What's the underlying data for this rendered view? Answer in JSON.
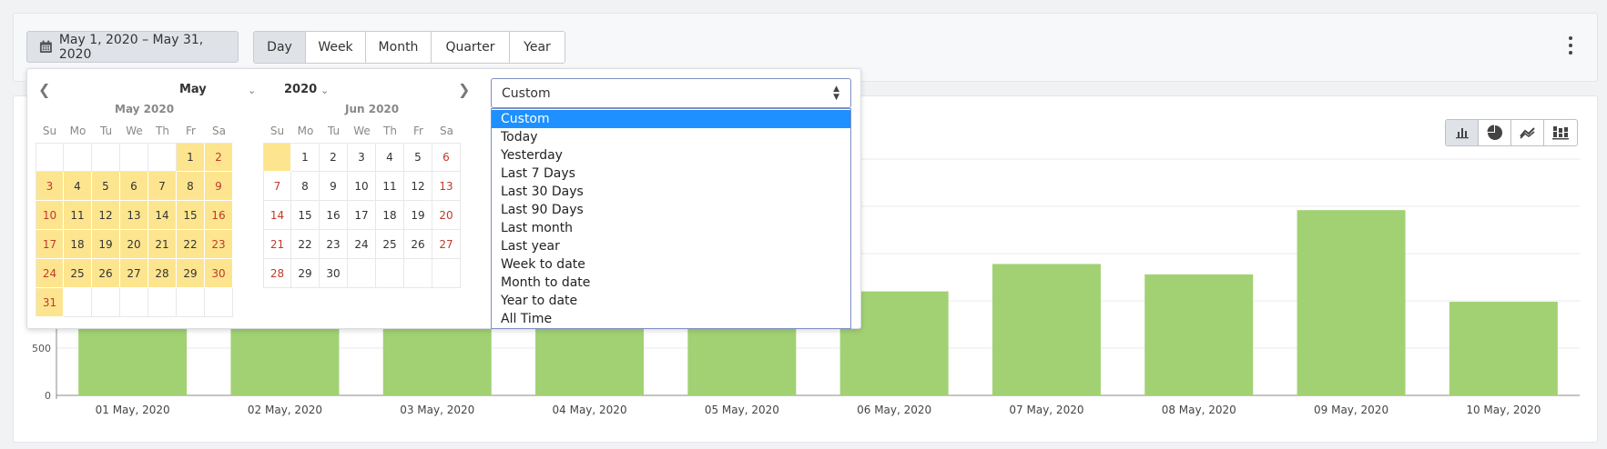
{
  "toolbar": {
    "date_range": "May 1, 2020 – May 31, 2020",
    "periods": [
      "Day",
      "Week",
      "Month",
      "Quarter",
      "Year"
    ],
    "active_period": "Day"
  },
  "picker": {
    "month_select": "May",
    "year_select": "2020",
    "weekdays": [
      "Su",
      "Mo",
      "Tu",
      "We",
      "Th",
      "Fr",
      "Sa"
    ],
    "months": [
      {
        "caption": "May 2020",
        "first_weekday": 5,
        "days": 31,
        "selected_from": 1,
        "selected_to": 31,
        "highlight_blank": false
      },
      {
        "caption": "Jun 2020",
        "first_weekday": 1,
        "days": 30,
        "selected_from": 0,
        "selected_to": 0,
        "highlight_blank": true
      }
    ],
    "range_select": {
      "value": "Custom",
      "options": [
        "Custom",
        "Today",
        "Yesterday",
        "Last 7 Days",
        "Last 30 Days",
        "Last 90 Days",
        "Last month",
        "Last year",
        "Week to date",
        "Month to date",
        "Year to date",
        "All Time"
      ],
      "active": "Custom"
    }
  },
  "chart_icons": [
    "bar-chart-icon",
    "pie-chart-icon",
    "line-chart-icon",
    "stacked-chart-icon"
  ],
  "colors": {
    "bar": "#a2d173",
    "selected_day": "#fde58f",
    "dropdown_active": "#1e90ff",
    "weekend_text": "#c0392b"
  },
  "chart_data": {
    "type": "bar",
    "categories": [
      "01 May, 2020",
      "02 May, 2020",
      "03 May, 2020",
      "04 May, 2020",
      "05 May, 2020",
      "06 May, 2020",
      "07 May, 2020",
      "08 May, 2020",
      "09 May, 2020",
      "10 May, 2020"
    ],
    "values": [
      1600,
      1450,
      1500,
      1480,
      1850,
      1100,
      1390,
      1280,
      1960,
      990
    ],
    "yticks": [
      0,
      500
    ],
    "ylim": [
      0,
      2500
    ],
    "grid": true
  }
}
